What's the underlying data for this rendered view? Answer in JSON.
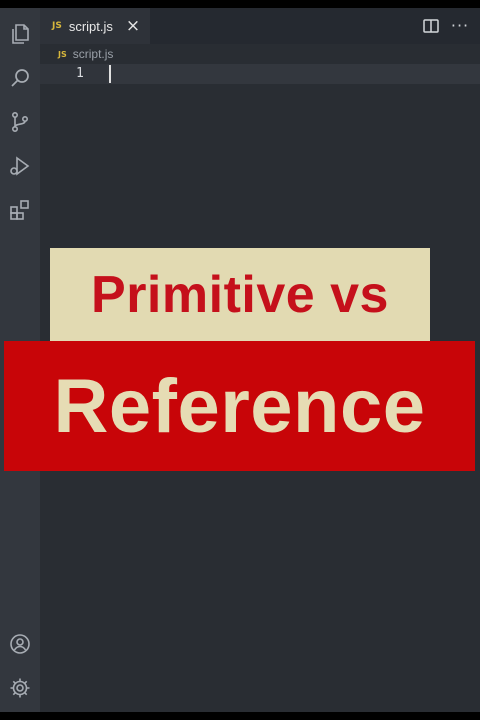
{
  "tabs": [
    {
      "icon": "js-file-icon",
      "badge": "JS",
      "label": "script.js",
      "close_symbol": "×"
    }
  ],
  "breadcrumb": {
    "badge": "JS",
    "label": "script.js"
  },
  "editor": {
    "line_numbers": [
      "1"
    ],
    "lines": [
      ""
    ]
  },
  "overlay": {
    "line1": "Primitive vs",
    "line2": "Reference"
  },
  "colors": {
    "editor_bg": "#292d33",
    "activity_bar": "#33373e",
    "overlay_red": "#c80508",
    "overlay_cream": "#e2dab2",
    "js_badge": "#d7b73c"
  },
  "activity_bar": {
    "top_icons": [
      "files-icon",
      "search-icon",
      "source-control-icon",
      "run-debug-icon",
      "extensions-icon"
    ],
    "bottom_icons": [
      "account-icon",
      "settings-gear-icon"
    ]
  }
}
